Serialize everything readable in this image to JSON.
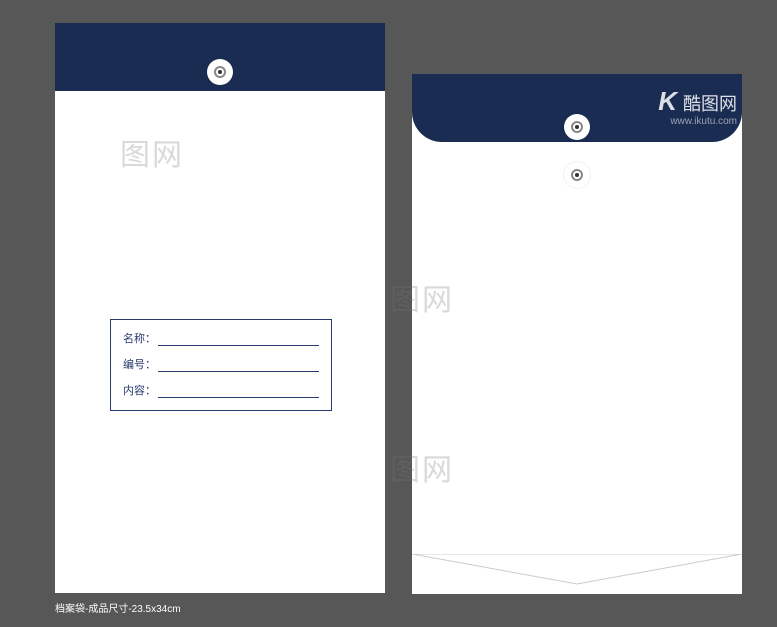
{
  "info_box": {
    "label_name": "名称：",
    "label_number": "编号：",
    "label_content": "内容："
  },
  "caption": "档案袋-成品尺寸-23.5x34cm",
  "watermarks": {
    "text": "图网",
    "logo_k": "K",
    "logo_text": "酷图网",
    "url": "www.ikutu.com"
  }
}
